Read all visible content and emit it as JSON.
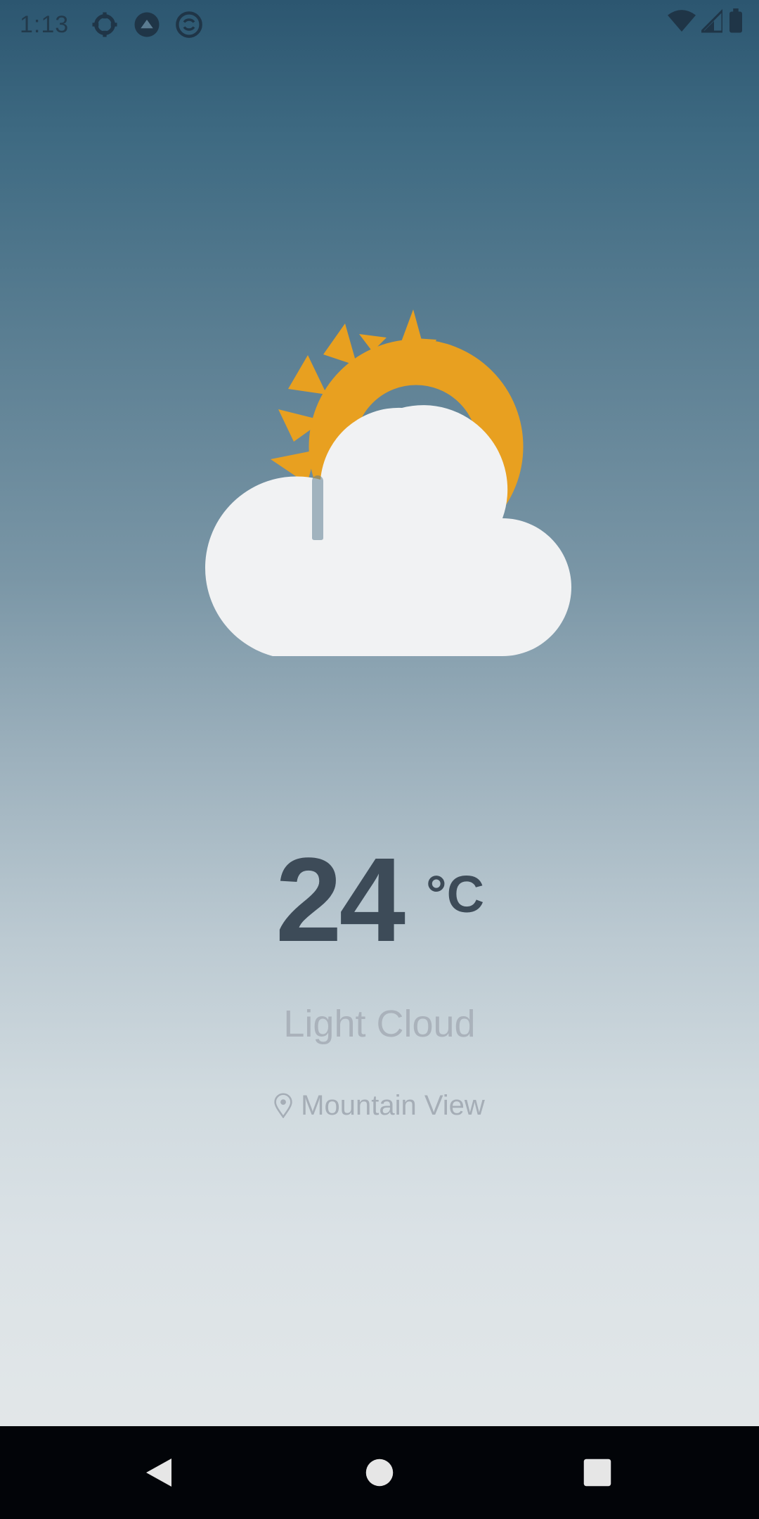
{
  "status_bar": {
    "time": "1:13",
    "left_icons": [
      "settings-gear-icon",
      "notification-circle-icon",
      "sync-circle-icon"
    ],
    "right_icons": [
      "wifi-icon",
      "cell-signal-icon",
      "battery-icon"
    ]
  },
  "weather": {
    "icon": "partly-cloudy-icon",
    "colors": {
      "sun": "#e8a020",
      "cloud": "#f1f2f3"
    },
    "temperature": "24",
    "unit": "°C",
    "condition": "Light Cloud",
    "location": "Mountain View"
  },
  "nav_bar": {
    "buttons": [
      "back-icon",
      "home-icon",
      "recents-icon"
    ]
  }
}
